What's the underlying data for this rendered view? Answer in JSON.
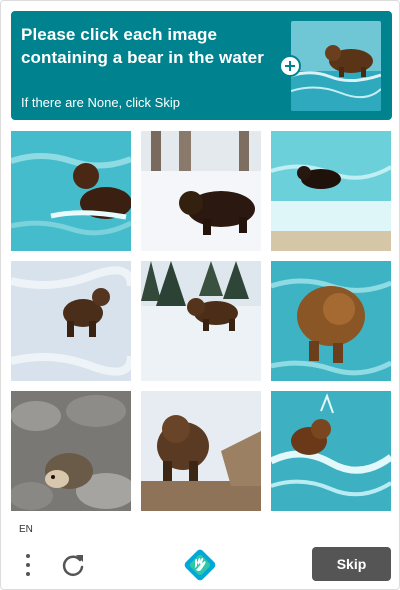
{
  "challenge": {
    "prompt": "Please click each image containing a bear in the water",
    "hint": "If there are None, click Skip",
    "example_image": "bear-walking-in-water-photo"
  },
  "grid": {
    "images": [
      {
        "description": "brown bear swimming in teal water"
      },
      {
        "description": "black bear walking on snow in forest"
      },
      {
        "description": "black bear in ocean surf"
      },
      {
        "description": "brown bear standing on snowy ground"
      },
      {
        "description": "bear walking on snow near pine trees"
      },
      {
        "description": "brown bear wading through water"
      },
      {
        "description": "hedgehog among rocks"
      },
      {
        "description": "bear standing on rocky snowy shore"
      },
      {
        "description": "bear splashing in waves"
      }
    ]
  },
  "footer": {
    "language": "EN",
    "skip_label": "Skip",
    "icons": [
      "menu-dots-icon",
      "refresh-icon",
      "hcaptcha-logo-icon"
    ]
  },
  "colors": {
    "header_bg": "#00838f",
    "skip_bg": "#555555",
    "water": "#3cb7c8"
  }
}
